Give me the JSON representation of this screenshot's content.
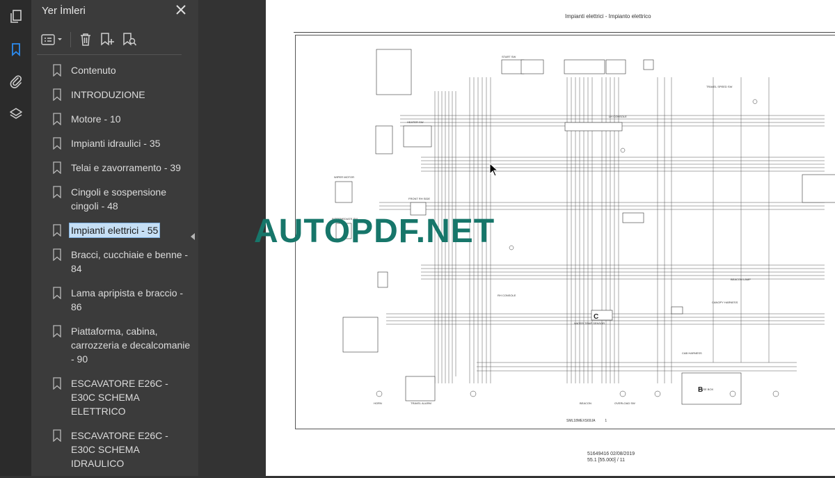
{
  "sidebar_rail": {
    "icons": [
      "pages-icon",
      "bookmarks-icon",
      "attachments-icon",
      "layers-icon"
    ],
    "active": "bookmarks-icon",
    "accent": "#2d8cf0"
  },
  "bookmarks_panel": {
    "title": "Yer İmleri",
    "items": [
      {
        "label": "Contenuto"
      },
      {
        "label": "INTRODUZIONE"
      },
      {
        "label": "Motore - 10"
      },
      {
        "label": "Impianti idraulici - 35"
      },
      {
        "label": "Telai e zavorramento - 39"
      },
      {
        "label": "Cingoli e sospensione cingoli - 48"
      },
      {
        "label": "Impianti elettrici - 55",
        "selected": true
      },
      {
        "label": "Bracci, cucchiaie e benne - 84"
      },
      {
        "label": "Lama apripista e braccio - 86"
      },
      {
        "label": "Piattaforma, cabina, carrozzeria e decalcomanie - 90"
      },
      {
        "label": "ESCAVATORE E26C - E30C SCHEMA ELETTRICO"
      },
      {
        "label": "ESCAVATORE E26C - E30C SCHEMA IDRAULICO"
      }
    ]
  },
  "document": {
    "header": "Impianti elettrici - Impianto elettrico",
    "diagram_labels": {
      "lh_console": "LH CONSOLE",
      "rh_console": "RH CONSOLE",
      "start_sw": "START SW",
      "heater_sw": "HEATER SW",
      "wiper_motor": "WIPER MOTOR",
      "front_rh_side": "FRONT RH SIDE",
      "intermediate_sw": "INTERMEDIATE SW",
      "travel_speed_sw": "TRAVEL SPEED SW",
      "beacon_lamp": "BEACON LAMP",
      "canopy_harness": "CANOPY HARNESS",
      "cab_harness": "CAB HARNESS",
      "horn": "HORN",
      "travel_alarm": "TRAVEL ALARM",
      "dipper_temp_sensor": "WATER TEMP SENSOR",
      "overload_sw": "OVERLOAD SW",
      "beacon": "BEACON",
      "fuse_box": "FUSE BOX",
      "block_c": "C",
      "block_b": "B"
    },
    "footer_code": "SML18MEXS69JA",
    "footer_sheet": "1",
    "footer_doc": "51649416 02/08/2019",
    "footer_page": "55.1 [55.000] / 11"
  },
  "watermark": "AUTOPDF.NET"
}
